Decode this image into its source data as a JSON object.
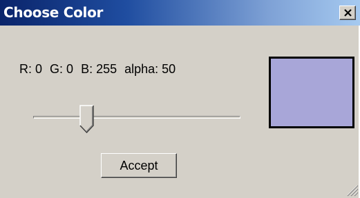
{
  "window": {
    "title": "Choose Color",
    "close_glyph": "close-icon"
  },
  "color": {
    "r_label": "R: 0",
    "g_label": "G: 0",
    "b_label": "B: 255",
    "alpha_label": "alpha: 50",
    "r": 0,
    "g": 0,
    "b": 255,
    "alpha": 50,
    "preview_color": "#a8a6d8"
  },
  "slider": {
    "value_fraction": 0.24
  },
  "actions": {
    "accept_label": "Accept"
  },
  "icons": {
    "resize": "resize-grip-icon"
  }
}
